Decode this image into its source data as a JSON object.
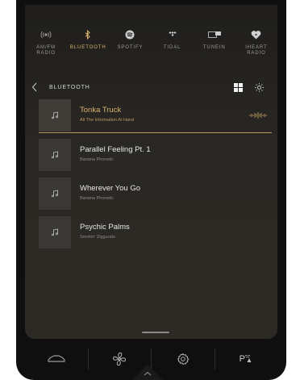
{
  "sources": [
    {
      "id": "amfm",
      "label": "AM/FM\nRADIO",
      "icon": "radio-waves-icon",
      "active": false
    },
    {
      "id": "bt",
      "label": "BLUETOOTH",
      "icon": "bluetooth-icon",
      "active": true
    },
    {
      "id": "spotify",
      "label": "SPOTIFY",
      "icon": "spotify-icon",
      "active": false
    },
    {
      "id": "tidal",
      "label": "TIDAL",
      "icon": "tidal-icon",
      "active": false
    },
    {
      "id": "tunein",
      "label": "TUNEIN",
      "icon": "tunein-icon",
      "active": false
    },
    {
      "id": "iheart",
      "label": "IHEART\nRADIO",
      "icon": "iheart-icon",
      "active": false
    }
  ],
  "header": {
    "title": "BLUETOOTH"
  },
  "tracks": [
    {
      "title": "Tonka Truck",
      "subtitle": "All The Information At Hand",
      "active": true
    },
    {
      "title": "Parallel Feeling Pt. 1",
      "subtitle": "Banana Phonetic",
      "active": false
    },
    {
      "title": "Wherever You Go",
      "subtitle": "Banana Phonetic",
      "active": false
    },
    {
      "title": "Psychic Palms",
      "subtitle": "Smokin' Ziggurats",
      "active": false
    }
  ],
  "dock": {
    "park_label": "P"
  },
  "colors": {
    "accent": "#d9b36e",
    "accent_dim": "#b8975d",
    "text": "#e8e8e8",
    "muted": "#8c8a86"
  }
}
